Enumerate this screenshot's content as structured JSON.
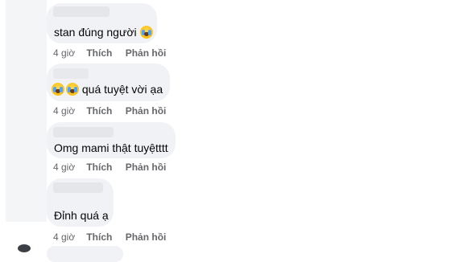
{
  "comments": [
    {
      "text": "stan đúng người",
      "emoji": "crying-face",
      "time": "4 giờ",
      "like": "Thích",
      "reply": "Phản hồi"
    },
    {
      "text": "quá tuyệt vời ạa",
      "emoji": "crying-face",
      "time": "4 giờ",
      "like": "Thích",
      "reply": "Phản hồi"
    },
    {
      "text": "Omg mami thật tuyệtttt",
      "time": "4 giờ",
      "like": "Thích",
      "reply": "Phản hồi"
    },
    {
      "text": "Đỉnh quá ạ",
      "time": "4 giờ",
      "like": "Thích",
      "reply": "Phản hồi"
    }
  ]
}
